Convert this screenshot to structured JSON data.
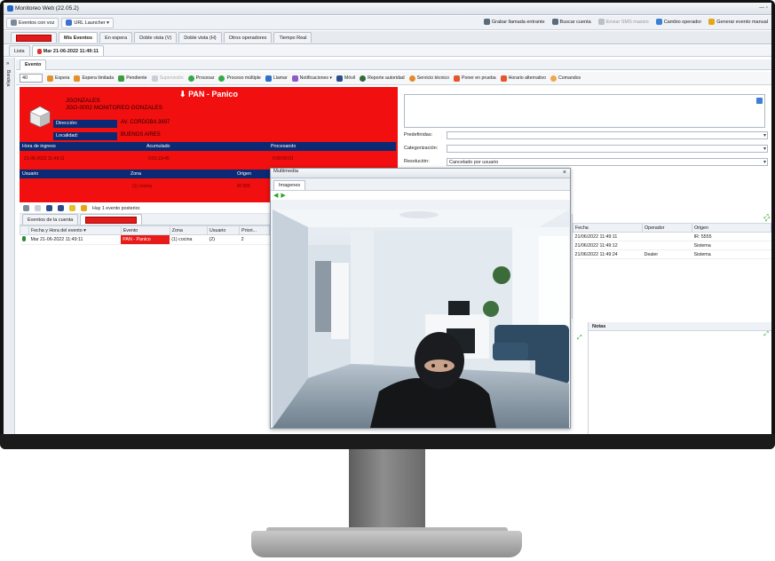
{
  "app": {
    "title": "Monitoreo Web (22.05.2)"
  },
  "toolbar": {
    "btn1": "Eventos con voz",
    "btn2": "URL Launcher ▾",
    "right": [
      "Grabar llamada entrante",
      "Buscar cuenta",
      "Enviar SMS masivo",
      "Cambio operador",
      "Generar evento manual"
    ]
  },
  "main_tabs": [
    "Mis Eventos",
    "En espera",
    "Doble vista (V)",
    "Doble vista (H)",
    "Otros operadores",
    "Tiempo Real"
  ],
  "sub_tabs": [
    "Lista",
    "Mar 21-06-2022 11:49:11"
  ],
  "event_tab": "Evento",
  "sidebar_label": "Bandeja",
  "actions": {
    "count": "40",
    "items": [
      "Espera",
      "Espera limitada",
      "Pendiente",
      "Supervisión",
      "Procesar",
      "Proceso múltiple",
      "Llamar",
      "Notificaciones ▾",
      "Móvil",
      "Reporte autoridad",
      "Servicio técnico",
      "Poner en prueba",
      "Horario alternativo",
      "Comandos"
    ]
  },
  "event": {
    "title": "PAN - Panico",
    "user": "JGONZALES",
    "account": "JGO-0002 MONITOREO GONZALES",
    "address_label": "Dirección:",
    "address": "AV. CORDOBA 3897",
    "city_label": "Localidad:",
    "city": "BUENOS AIRES",
    "hdr1": [
      "Hora de ingreso",
      "Acumulado",
      "Procesando"
    ],
    "vals1": [
      "21-06-2022 11:49:11",
      "0:01:19:45",
      "0:00:00:01"
    ],
    "hdr2": [
      "Usuario",
      "Zona",
      "Origen"
    ],
    "vals2": [
      "",
      "(1) cocina",
      "IR 555"
    ]
  },
  "resolution": {
    "predef_label": "Predefinidas:",
    "categ_label": "Categorización:",
    "resol_label": "Resolución:",
    "resol_value": "Cancelado por usuario"
  },
  "lower_left": {
    "info": "Hay 1 evento posterior.",
    "tab1": "Eventos de la cuenta",
    "columns": [
      "Fecha y Hora del evento ▾",
      "Evento",
      "Zona",
      "Usuario",
      "Priori..."
    ],
    "rows": [
      [
        "Mar 21-06-2022 11:49:11",
        "PAN - Panico",
        "(1) cocina",
        "(2)",
        "2"
      ]
    ]
  },
  "lower_right": {
    "columns": [
      "Fecha",
      "Operador",
      "Origen"
    ],
    "rows": [
      [
        "21/06/2022 11:49:11",
        "",
        "IR: 5555"
      ],
      [
        "21/06/2022 11:49:12",
        "",
        "Sistema"
      ],
      [
        "21/06/2022 11:49:24",
        "Dealer",
        "Sistema"
      ]
    ],
    "notes_title": "Notas"
  },
  "dialog": {
    "title": "Multimedia",
    "tab": "Imagenes"
  },
  "colors": {
    "alarm_red": "#f10f0f",
    "navy": "#0b2a73",
    "accent_green": "#2aa52a"
  }
}
